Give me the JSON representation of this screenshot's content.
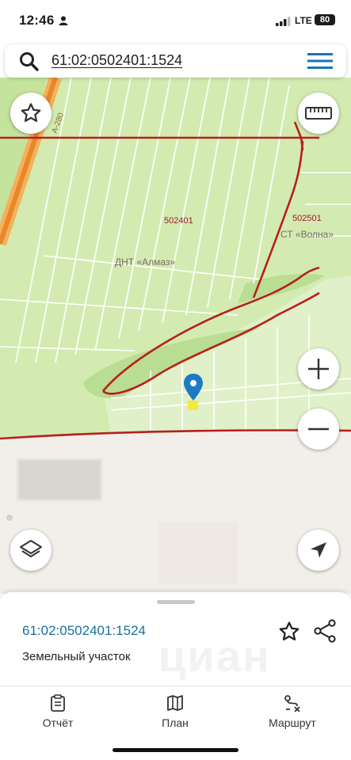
{
  "status_bar": {
    "time": "12:46",
    "network": "LTE",
    "battery": "80"
  },
  "search": {
    "query": "61:02:0502401:1524"
  },
  "map": {
    "labels": {
      "quarter_a": "502401",
      "quarter_b": "502501",
      "area_a": "ДНТ «Алмаз»",
      "area_b": "СТ «Волна»",
      "road": "А-280"
    }
  },
  "sheet": {
    "title": "61:02:0502401:1524",
    "subtitle": "Земельный участок",
    "watermark": "циан"
  },
  "tabbar": {
    "items": [
      {
        "label": "Отчёт",
        "icon": "report-icon"
      },
      {
        "label": "План",
        "icon": "map-icon"
      },
      {
        "label": "Маршрут",
        "icon": "route-icon"
      }
    ]
  },
  "colors": {
    "land": "#d4ecb1",
    "road": "#f2a541",
    "boundary": "#b81f1f",
    "link": "#1a6f9e",
    "pin": "#1d7bc5"
  }
}
